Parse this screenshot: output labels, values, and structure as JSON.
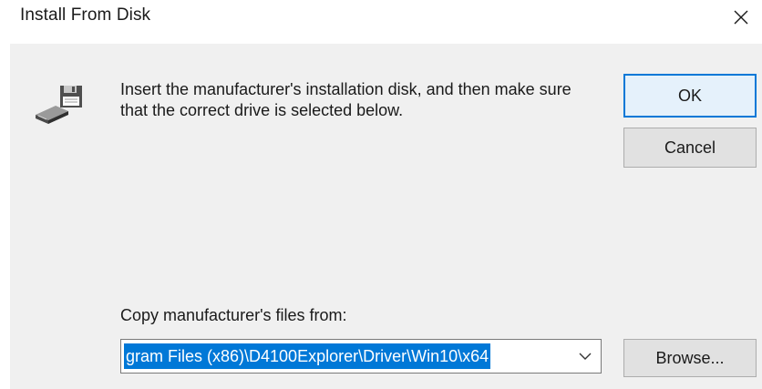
{
  "window": {
    "title": "Install From Disk",
    "close_icon": "close-icon"
  },
  "dialog": {
    "icon": "floppy-disk-drive-icon",
    "instruction": "Insert the manufacturer's installation disk, and then make sure that the correct drive is selected below.",
    "ok_label": "OK",
    "cancel_label": "Cancel",
    "copy_label": "Copy manufacturer's files from:",
    "path_value": "gram Files (x86)\\D4100Explorer\\Driver\\Win10\\x64",
    "path_dropdown_icon": "chevron-down-icon",
    "browse_label": "Browse..."
  },
  "colors": {
    "accent": "#0078d7",
    "dialog_background": "#f0f0f0",
    "button_face": "#e1e1e1",
    "selection_text": "#ffffff"
  }
}
